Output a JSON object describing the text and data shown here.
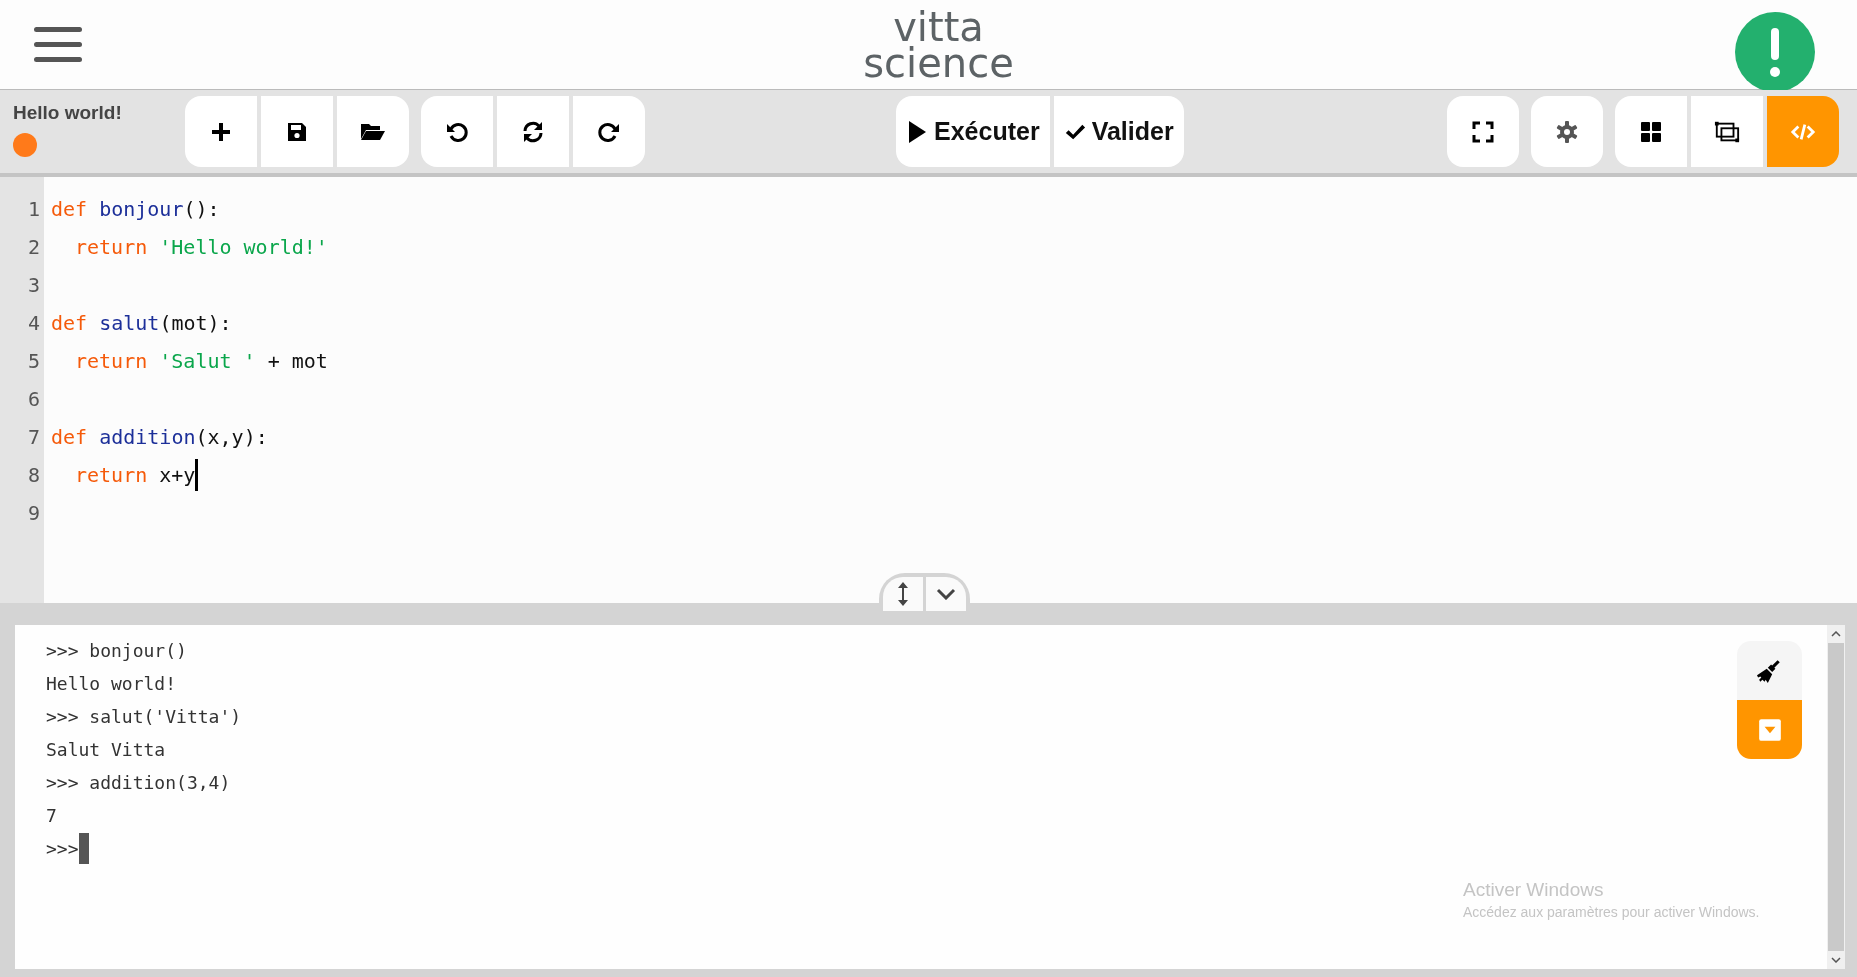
{
  "header": {
    "logo": [
      "vitta",
      "science"
    ]
  },
  "project": {
    "title": "Hello world!",
    "saved": false
  },
  "toolbar": {
    "groups": [
      {
        "buttons": [
          {
            "kind": "plus"
          },
          {
            "kind": "save"
          },
          {
            "kind": "folder"
          }
        ]
      },
      {
        "buttons": [
          {
            "kind": "undo"
          },
          {
            "kind": "sync"
          },
          {
            "kind": "redo"
          }
        ]
      },
      {
        "buttons": [
          {
            "kind": "run",
            "label": "Exécuter"
          },
          {
            "kind": "check",
            "label": "Valider"
          }
        ]
      },
      {
        "buttons": [
          {
            "kind": "fullscreen"
          }
        ]
      },
      {
        "buttons": [
          {
            "kind": "gear"
          }
        ]
      },
      {
        "buttons": [
          {
            "kind": "grid",
            "selected": false
          },
          {
            "kind": "simulator",
            "selected": false
          },
          {
            "kind": "code",
            "selected": true
          }
        ]
      }
    ]
  },
  "editor": {
    "lines": [
      {
        "number": "1",
        "tokens": [
          {
            "t": "def",
            "kind": "keyword"
          },
          {
            "t": " bonjour",
            "kind": "function"
          },
          {
            "t": "():",
            "kind": "plain"
          }
        ]
      },
      {
        "number": "2",
        "indented": true,
        "tokens": [
          {
            "t": "return",
            "kind": "keyword"
          },
          {
            "t": " 'Hello world!'",
            "kind": "string"
          }
        ]
      },
      {
        "number": "3"
      },
      {
        "number": "4",
        "tokens": [
          {
            "t": "def",
            "kind": "keyword"
          },
          {
            "t": " salut",
            "kind": "function"
          },
          {
            "t": "(mot):",
            "kind": "plain"
          }
        ]
      },
      {
        "number": "5",
        "indented": true,
        "tokens": [
          {
            "t": "return",
            "kind": "keyword"
          },
          {
            "t": " 'Salut '",
            "kind": "string"
          },
          {
            "t": " + mot",
            "kind": "plain"
          }
        ]
      },
      {
        "number": "6"
      },
      {
        "number": "7",
        "tokens": [
          {
            "t": "def",
            "kind": "keyword"
          },
          {
            "t": " addition",
            "kind": "function"
          },
          {
            "t": "(x,y):",
            "kind": "plain"
          }
        ]
      },
      {
        "number": "8",
        "indented": true,
        "cursor": true,
        "tokens": [
          {
            "t": "return",
            "kind": "keyword"
          },
          {
            "t": " x+y",
            "kind": "plain"
          }
        ]
      },
      {
        "number": "9"
      }
    ]
  },
  "console": {
    "lines": [
      ">>> bonjour()",
      "Hello world!",
      ">>> salut('Vitta')",
      "Salut Vitta",
      ">>> addition(3,4)",
      "7"
    ],
    "prompt": ">>>"
  },
  "os_notice": {
    "title": "Activer Windows",
    "text": "Accédez aux paramètres pour activer Windows."
  }
}
